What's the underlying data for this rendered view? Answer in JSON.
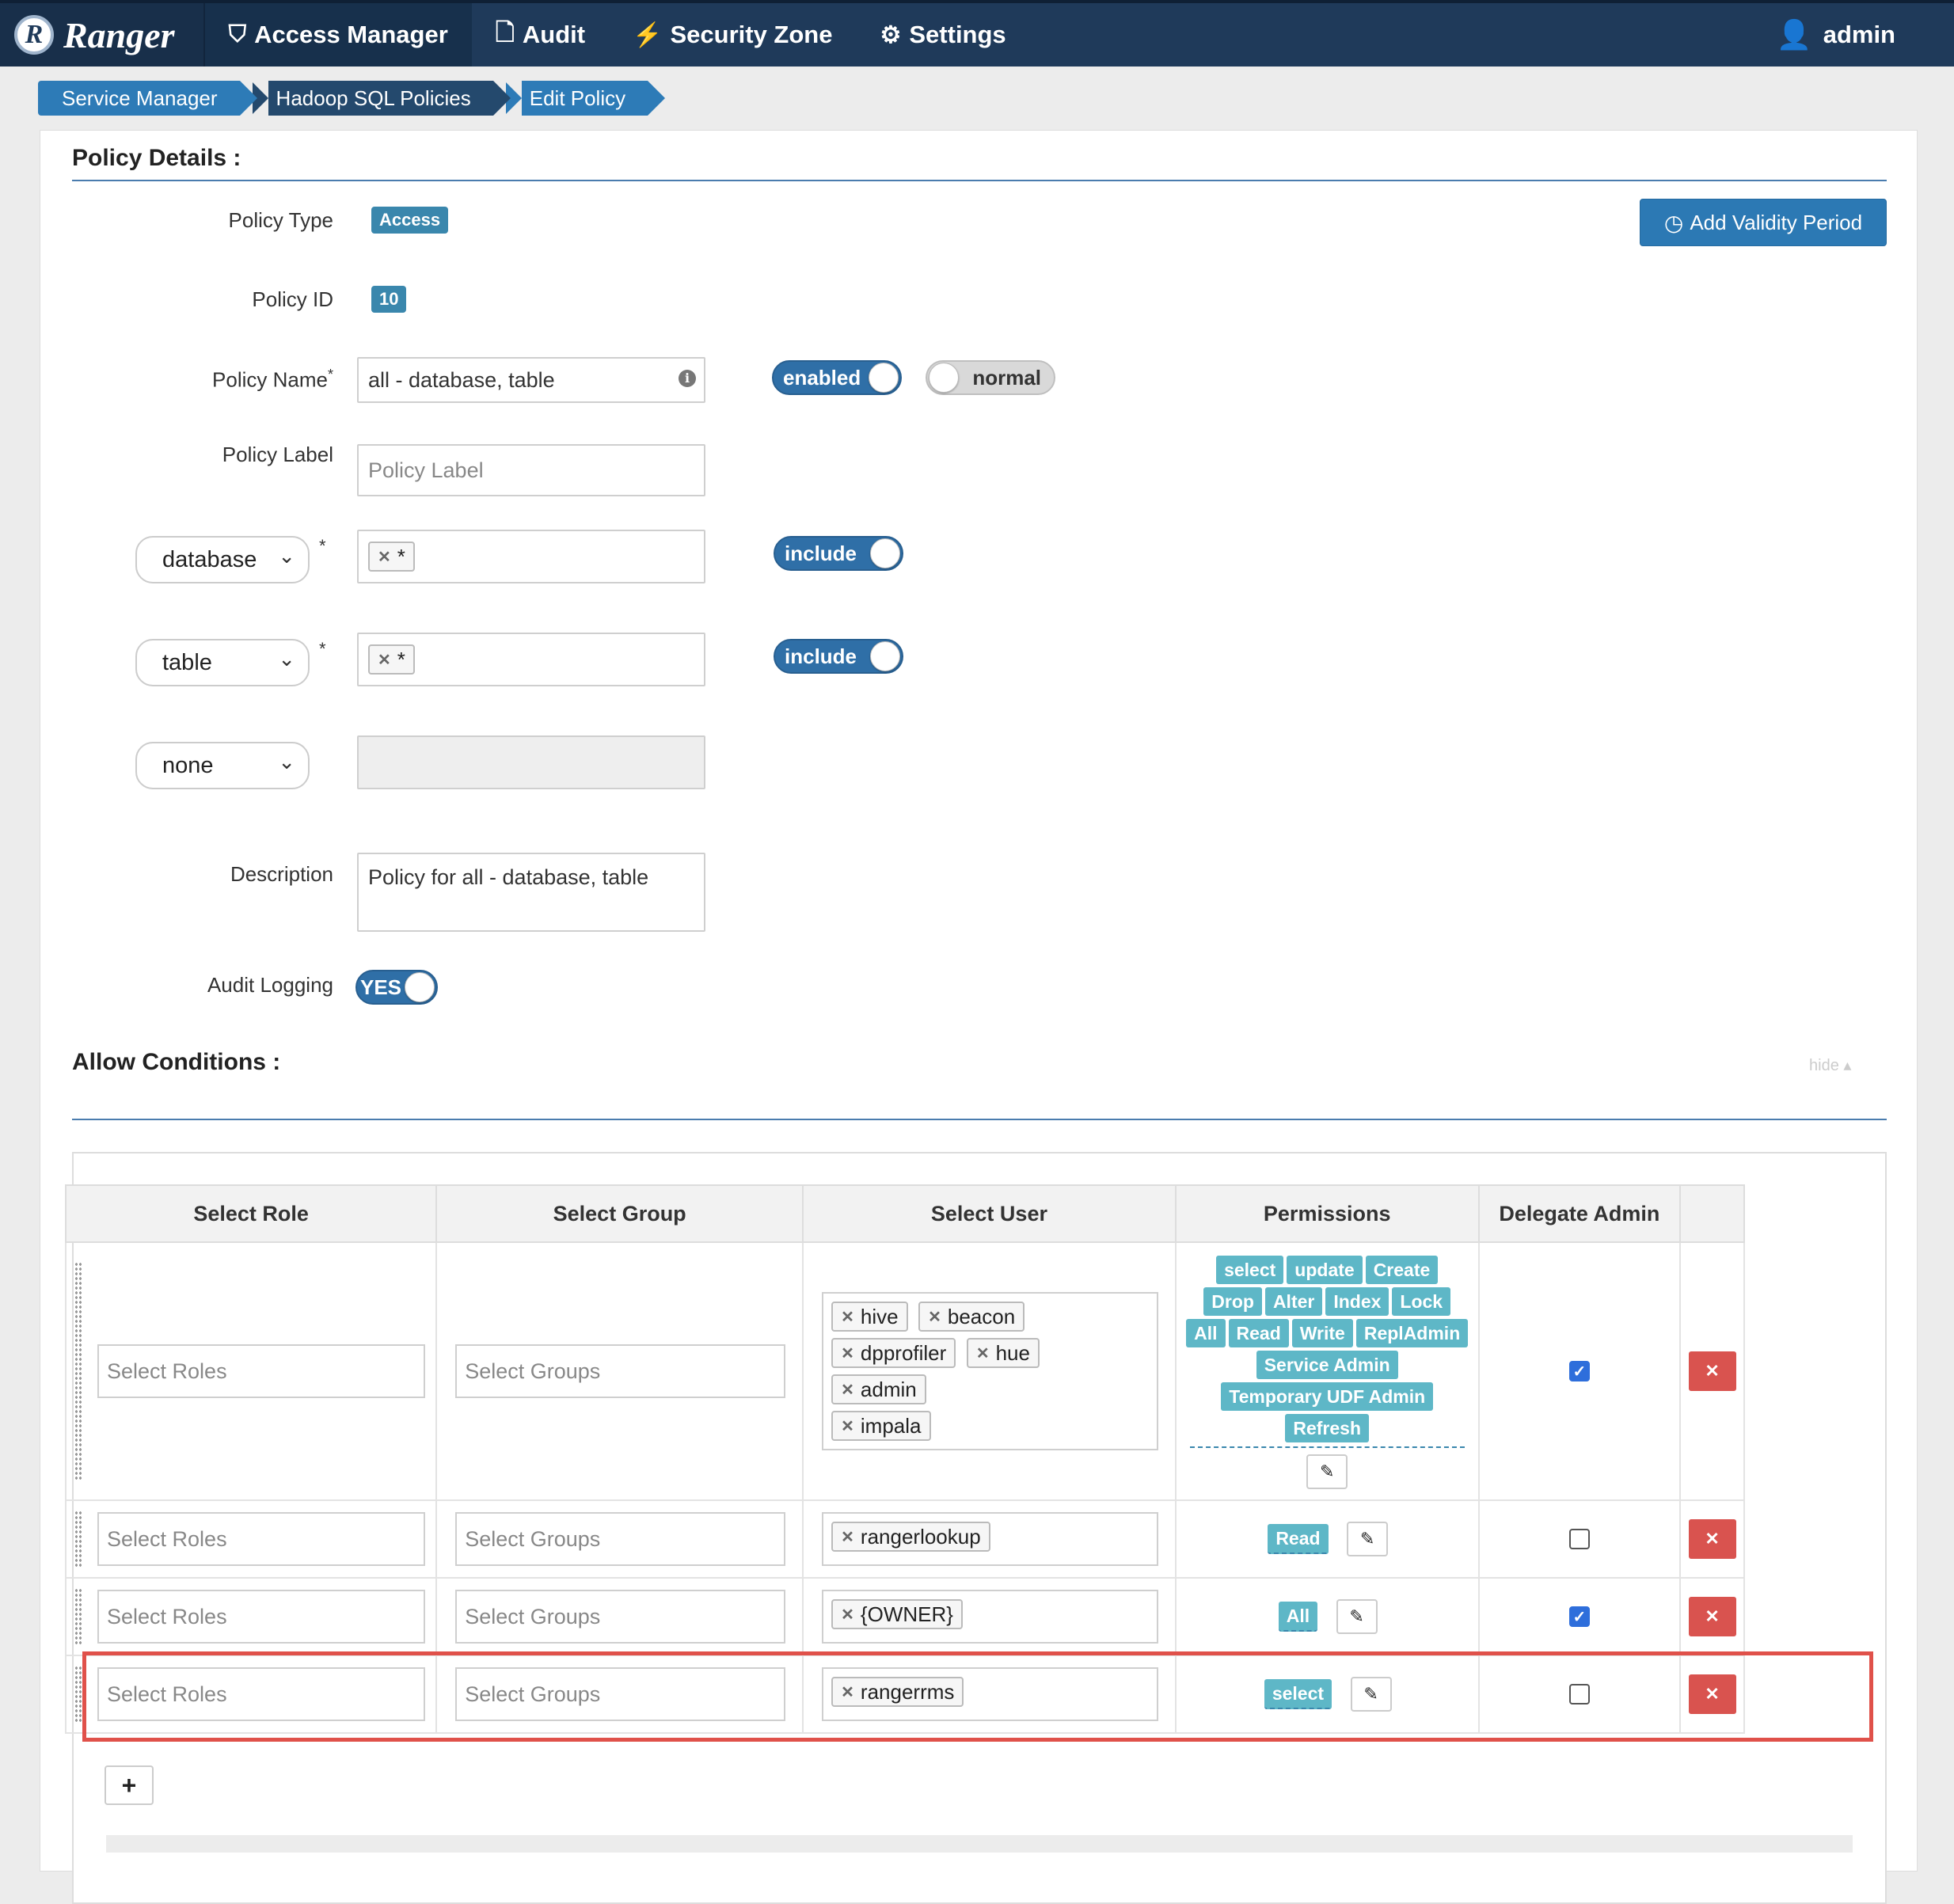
{
  "nav": {
    "brand": "Ranger",
    "brand_logo": "R",
    "items": [
      {
        "label": "Access Manager",
        "icon": "shield-icon"
      },
      {
        "label": "Audit",
        "icon": "file-icon"
      },
      {
        "label": "Security Zone",
        "icon": "bolt-icon"
      },
      {
        "label": "Settings",
        "icon": "gear-icon"
      }
    ],
    "user": "admin"
  },
  "breadcrumb": [
    "Service Manager",
    "Hadoop SQL Policies",
    "Edit Policy"
  ],
  "policy_details": {
    "title": "Policy Details :",
    "policy_type_label": "Policy Type",
    "policy_type": "Access",
    "policy_id_label": "Policy ID",
    "policy_id": "10",
    "policy_name_label": "Policy Name",
    "policy_name": "all - database, table",
    "enabled_toggle": "enabled",
    "normal_toggle": "normal",
    "policy_label_label": "Policy Label",
    "policy_label_placeholder": "Policy Label",
    "resources": [
      {
        "type": "database",
        "value": "*",
        "toggle": "include"
      },
      {
        "type": "table",
        "value": "*",
        "toggle": "include"
      },
      {
        "type": "none"
      }
    ],
    "description_label": "Description",
    "description": "Policy for all - database, table",
    "audit_label": "Audit Logging",
    "audit_value": "YES",
    "validity_button": "Add Validity Period",
    "required_mark": "*"
  },
  "allow_conditions": {
    "title": "Allow Conditions :",
    "hide_link": "hide",
    "headers": [
      "Select Role",
      "Select Group",
      "Select User",
      "Permissions",
      "Delegate Admin",
      ""
    ],
    "role_placeholder": "Select Roles",
    "group_placeholder": "Select Groups",
    "rows": [
      {
        "users": [
          "hive",
          "beacon",
          "dpprofiler",
          "hue",
          "admin",
          "impala"
        ],
        "permissions": [
          "select",
          "update",
          "Create",
          "Drop",
          "Alter",
          "Index",
          "Lock",
          "All",
          "Read",
          "Write",
          "ReplAdmin",
          "Service Admin",
          "Temporary UDF Admin",
          "Refresh"
        ],
        "delegate": true
      },
      {
        "users": [
          "rangerlookup"
        ],
        "permissions": [
          "Read"
        ],
        "delegate": false
      },
      {
        "users": [
          "{OWNER}"
        ],
        "permissions": [
          "All"
        ],
        "delegate": true
      },
      {
        "users": [
          "rangerrms"
        ],
        "permissions": [
          "select"
        ],
        "delegate": false
      }
    ],
    "add_button": "+"
  },
  "colors": {
    "navbar": "#1f3a5a",
    "accent": "#2c79b4",
    "permission": "#5eb7c7",
    "danger": "#d9534f",
    "highlight": "#e0514a"
  }
}
